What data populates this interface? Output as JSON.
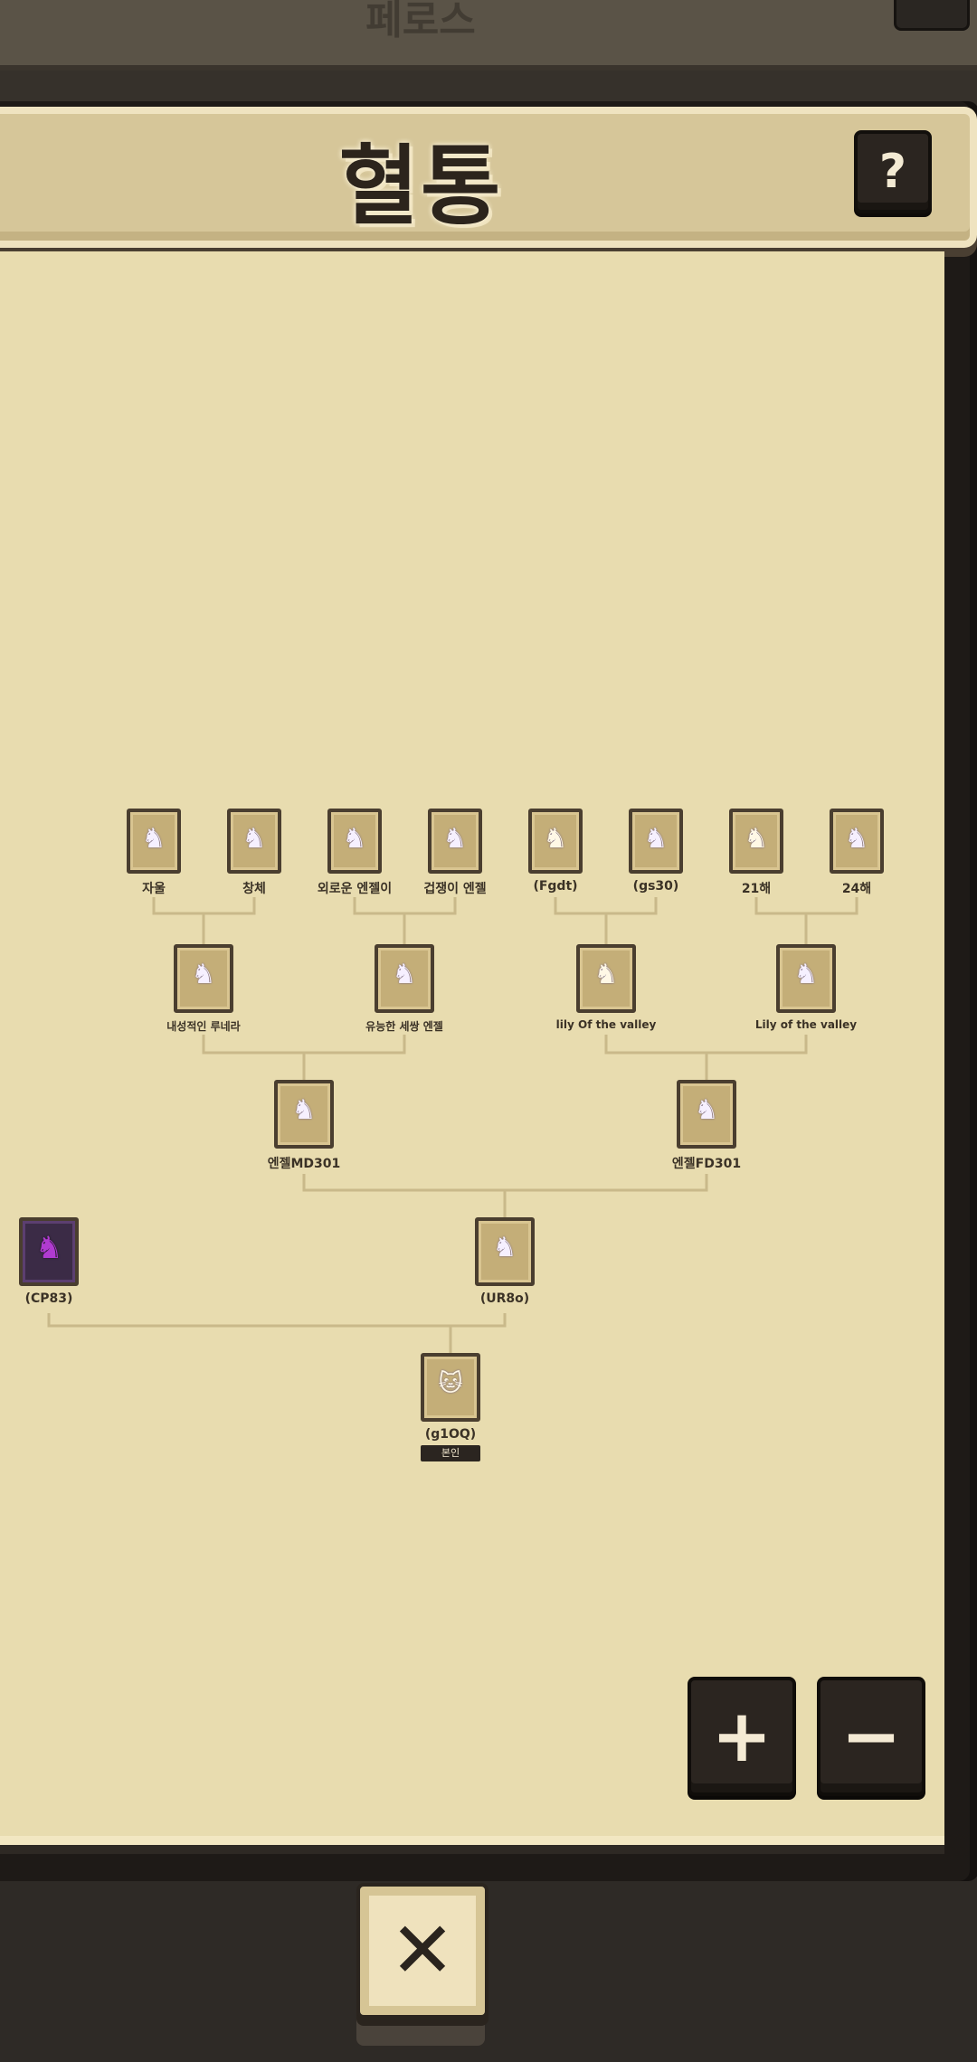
{
  "back_screen": {
    "title": "페로스"
  },
  "header": {
    "title": "혈통",
    "help_label": "?"
  },
  "tree": {
    "gen4": [
      {
        "name": "자울"
      },
      {
        "name": "창체"
      },
      {
        "name": "외로운 엔젤이"
      },
      {
        "name": "겁쟁이 엔젤"
      },
      {
        "name": "(Fgdt)"
      },
      {
        "name": "(gs30)"
      },
      {
        "name": "21해"
      },
      {
        "name": "24해"
      }
    ],
    "gen3": [
      {
        "name": "내성적인 루네라"
      },
      {
        "name": "유능한 세쌍 엔젤"
      },
      {
        "name": "lily Of the valley"
      },
      {
        "name": "Lily of the valley"
      }
    ],
    "gen2": [
      {
        "name": "엔젤MD301"
      },
      {
        "name": "엔젤FD301"
      }
    ],
    "gen1": [
      {
        "name": "(CP83)"
      },
      {
        "name": "(UR8o)"
      }
    ],
    "self": {
      "name": "(g1OQ)",
      "badge": "본인"
    }
  },
  "controls": {
    "zoom_in": "+",
    "zoom_out": "−",
    "close": "✕"
  },
  "icons": {
    "creature": "unicorn-icon",
    "self": "cat-icon"
  }
}
